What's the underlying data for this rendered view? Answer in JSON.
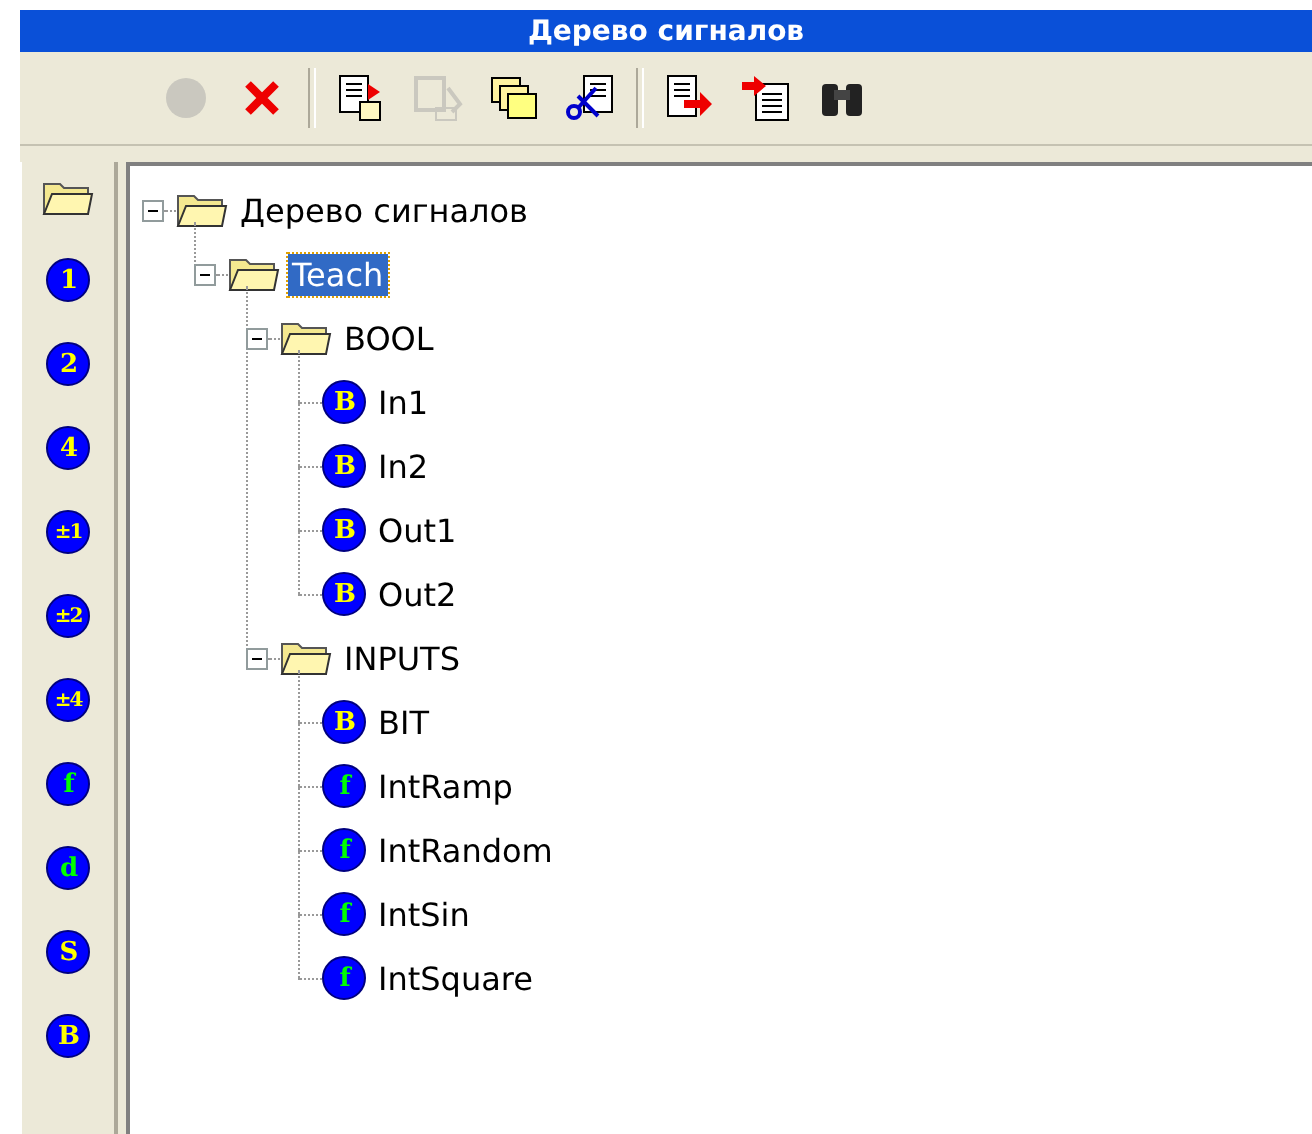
{
  "window": {
    "title": "Дерево сигналов"
  },
  "toolbar": [
    {
      "kind": "record",
      "disabled": true
    },
    {
      "kind": "delete",
      "disabled": false
    },
    {
      "kind": "separator"
    },
    {
      "kind": "paste-doc",
      "disabled": false
    },
    {
      "kind": "doc-edit",
      "disabled": true
    },
    {
      "kind": "stack",
      "disabled": false
    },
    {
      "kind": "cut-doc",
      "disabled": false
    },
    {
      "kind": "separator"
    },
    {
      "kind": "export",
      "disabled": false
    },
    {
      "kind": "import",
      "disabled": false
    },
    {
      "kind": "find",
      "disabled": false
    }
  ],
  "sidebar": {
    "items": [
      {
        "kind": "folder"
      },
      {
        "kind": "int",
        "badge": "1"
      },
      {
        "kind": "int",
        "badge": "2"
      },
      {
        "kind": "int",
        "badge": "4"
      },
      {
        "kind": "int",
        "badge": "±1"
      },
      {
        "kind": "int",
        "badge": "±2"
      },
      {
        "kind": "int",
        "badge": "±4"
      },
      {
        "kind": "real",
        "badge": "f"
      },
      {
        "kind": "real",
        "badge": "d"
      },
      {
        "kind": "int",
        "badge": "S"
      },
      {
        "kind": "int",
        "badge": "B"
      }
    ]
  },
  "tree": [
    {
      "kind": "folder",
      "label": "Дерево сигналов",
      "expanded": true,
      "selected": false,
      "children": [
        {
          "kind": "folder",
          "label": "Teach",
          "expanded": true,
          "selected": true,
          "children": [
            {
              "kind": "folder",
              "label": "BOOL",
              "expanded": true,
              "selected": false,
              "children": [
                {
                  "kind": "int",
                  "label": "In1",
                  "badge": "B",
                  "selected": false
                },
                {
                  "kind": "int",
                  "label": "In2",
                  "badge": "B",
                  "selected": false
                },
                {
                  "kind": "int",
                  "label": "Out1",
                  "badge": "B",
                  "selected": false
                },
                {
                  "kind": "int",
                  "label": "Out2",
                  "badge": "B",
                  "selected": false
                }
              ]
            },
            {
              "kind": "folder",
              "label": "INPUTS",
              "expanded": true,
              "selected": false,
              "children": [
                {
                  "kind": "int",
                  "label": "BIT",
                  "badge": "B",
                  "selected": false
                },
                {
                  "kind": "real",
                  "label": "IntRamp",
                  "badge": "f",
                  "selected": false
                },
                {
                  "kind": "real",
                  "label": "IntRandom",
                  "badge": "f",
                  "selected": false
                },
                {
                  "kind": "real",
                  "label": "IntSin",
                  "badge": "f",
                  "selected": false
                },
                {
                  "kind": "real",
                  "label": "IntSquare",
                  "badge": "f",
                  "selected": false
                }
              ]
            }
          ]
        }
      ]
    }
  ]
}
